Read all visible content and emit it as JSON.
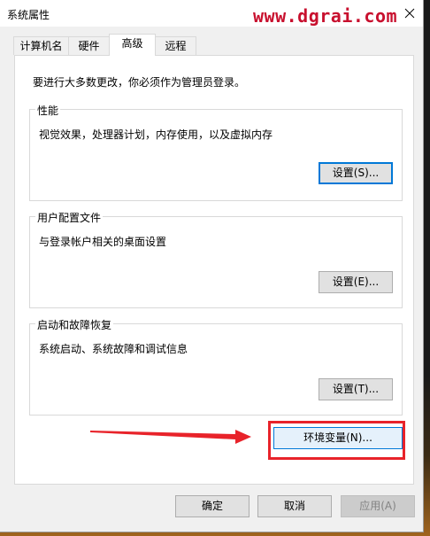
{
  "window": {
    "title": "系统属性",
    "watermark": "www.dgrai.com",
    "close_icon": "close-icon"
  },
  "tabs": [
    {
      "label": "计算机名",
      "active": false
    },
    {
      "label": "硬件",
      "active": false
    },
    {
      "label": "高级",
      "active": true
    },
    {
      "label": "远程",
      "active": false
    }
  ],
  "panel": {
    "admin_note": "要进行大多数更改，你必须作为管理员登录。",
    "performance": {
      "title": "性能",
      "description": "视觉效果，处理器计划，内存使用，以及虚拟内存",
      "button": "设置(S)..."
    },
    "user_profiles": {
      "title": "用户配置文件",
      "description": "与登录帐户相关的桌面设置",
      "button": "设置(E)..."
    },
    "startup_recovery": {
      "title": "启动和故障恢复",
      "description": "系统启动、系统故障和调试信息",
      "button": "设置(T)..."
    },
    "env_button": "环境变量(N)..."
  },
  "footer": {
    "ok": "确定",
    "cancel": "取消",
    "apply": "应用(A)"
  },
  "colors": {
    "accent": "#0078d7",
    "annotation": "#e8232a",
    "watermark": "#c8102e"
  }
}
